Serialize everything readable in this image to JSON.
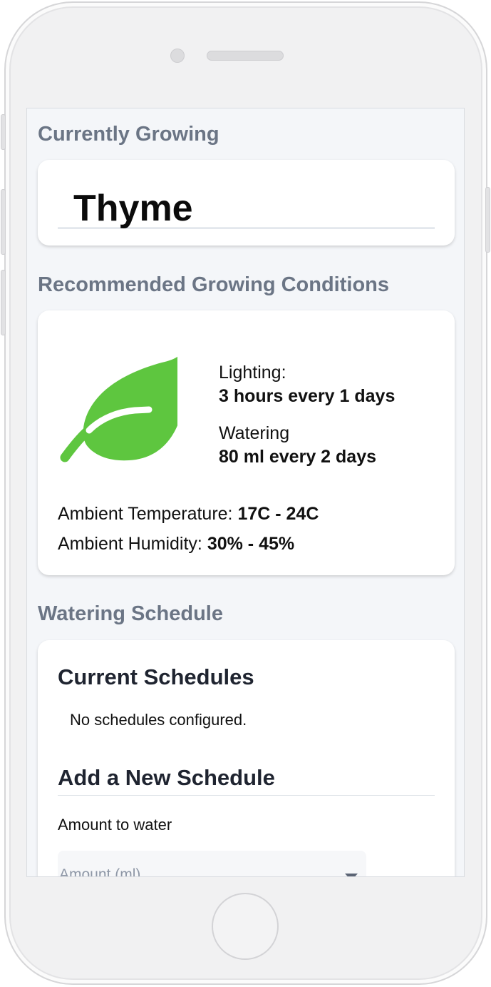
{
  "current": {
    "section_title": "Currently Growing",
    "plant_name": "Thyme"
  },
  "conditions": {
    "section_title": "Recommended Growing Conditions",
    "icon": "leaf-icon",
    "icon_color": "#5ec63f",
    "lighting_label": "Lighting:",
    "lighting_value": "3 hours every 1 days",
    "watering_label": "Watering",
    "watering_value": "80 ml every 2 days",
    "temperature_label": "Ambient Temperature:",
    "temperature_value": "17C - 24C",
    "humidity_label": "Ambient Humidity:",
    "humidity_value": "30% - 45%"
  },
  "schedule": {
    "section_title": "Watering Schedule",
    "current_heading": "Current Schedules",
    "empty_message": "No schedules configured.",
    "add_heading": "Add a New Schedule",
    "amount_label": "Amount to water",
    "amount_placeholder": "Amount (ml)"
  }
}
